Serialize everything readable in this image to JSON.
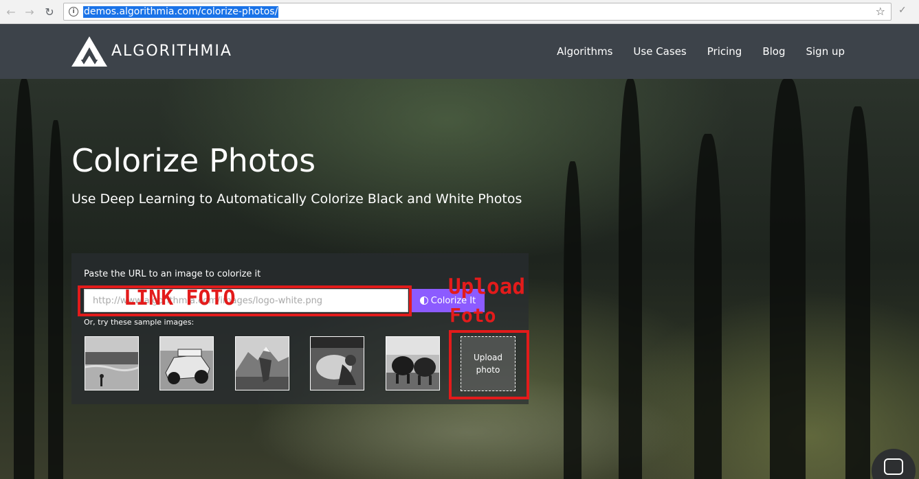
{
  "browser": {
    "url": "demos.algorithmia.com/colorize-photos/",
    "back_icon": "arrow-left-icon",
    "forward_icon": "arrow-right-icon",
    "reload_icon": "reload-icon",
    "bookmark_icon": "star-icon"
  },
  "header": {
    "logo_text": "ALGORITHMIA",
    "nav": [
      "Algorithms",
      "Use Cases",
      "Pricing",
      "Blog",
      "Sign up"
    ]
  },
  "hero": {
    "title": "Colorize Photos",
    "subtitle": "Use Deep Learning to Automatically Colorize Black and White Photos"
  },
  "form": {
    "label": "Paste the URL to an image to colorize it",
    "input_placeholder": "http://www.algorithmia.com/images/logo-white.png",
    "input_value": "",
    "button_label": "Colorize It",
    "samples_label": "Or, try these sample images:",
    "upload_label_line1": "Upload",
    "upload_label_line2": "photo"
  },
  "annotations": {
    "link_label": "LINK FOTO",
    "upload_label_line1": "Upload",
    "upload_label_line2": "Foto",
    "color": "#e31b1b"
  },
  "colors": {
    "header_bg": "#3d434a",
    "accent_button": "#8c5bff"
  }
}
